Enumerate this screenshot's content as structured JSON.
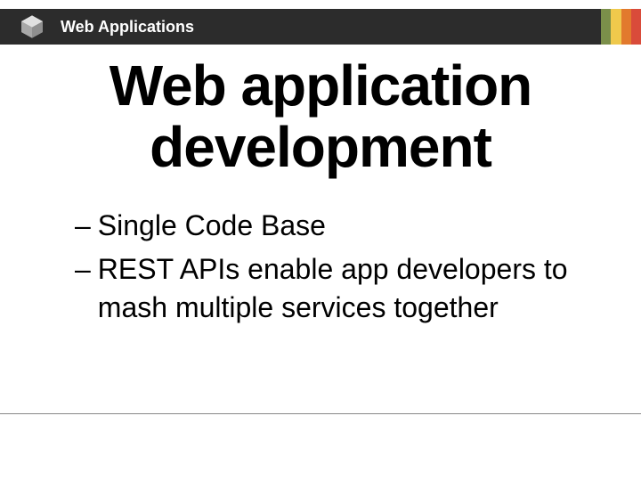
{
  "header": {
    "title": "Web Applications",
    "logo_name": "cube-logo",
    "stripe_colors": [
      "#7b8f4a",
      "#efc94c",
      "#e27a2d",
      "#d94b3a"
    ]
  },
  "slide": {
    "title": "Web application development",
    "bullets": [
      "Single Code Base",
      "REST APIs enable app developers to mash multiple services together"
    ]
  }
}
